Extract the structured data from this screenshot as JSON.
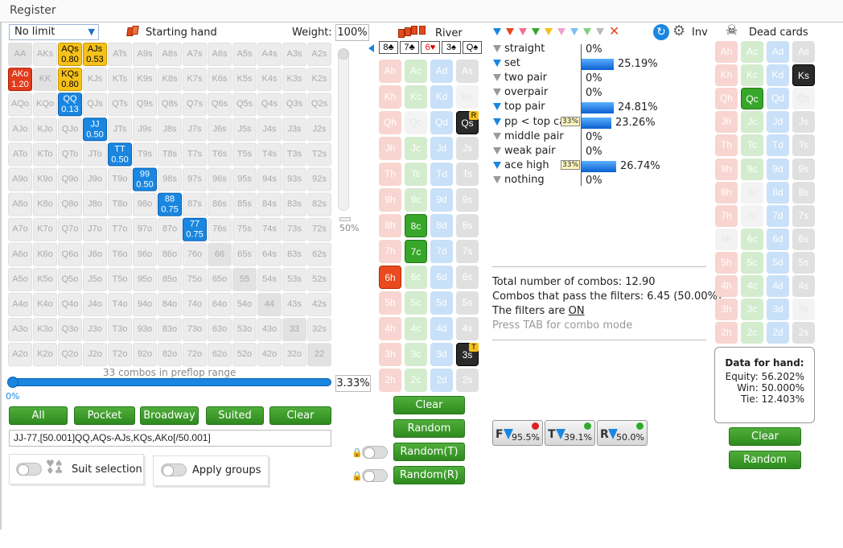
{
  "register": "Register",
  "limit": {
    "value": "No limit"
  },
  "starting_hand": "Starting hand",
  "weight": {
    "label": "Weight:",
    "value": "100%"
  },
  "slider_pct": "50%",
  "range_summary": "33 combos in preflop range",
  "range_pct": "3.33%",
  "range_left_pct": "0%",
  "grid": [
    [
      "AA",
      "AKs",
      "AQs|0.80",
      "AJs|0.53",
      "ATs",
      "A9s",
      "A8s",
      "A7s",
      "A6s",
      "A5s",
      "A4s",
      "A3s",
      "A2s"
    ],
    [
      "AKo|1.20",
      "KK",
      "KQs|0.80",
      "KJs",
      "KTs",
      "K9s",
      "K8s",
      "K7s",
      "K6s",
      "K5s",
      "K4s",
      "K3s",
      "K2s"
    ],
    [
      "AQo",
      "KQo",
      "QQ|0.13",
      "QJs",
      "QTs",
      "Q9s",
      "Q8s",
      "Q7s",
      "Q6s",
      "Q5s",
      "Q4s",
      "Q3s",
      "Q2s"
    ],
    [
      "AJo",
      "KJo",
      "QJo",
      "JJ|0.50",
      "JTs",
      "J9s",
      "J8s",
      "J7s",
      "J6s",
      "J5s",
      "J4s",
      "J3s",
      "J2s"
    ],
    [
      "ATo",
      "KTo",
      "QTo",
      "JTo",
      "TT|0.50",
      "T9s",
      "T8s",
      "T7s",
      "T6s",
      "T5s",
      "T4s",
      "T3s",
      "T2s"
    ],
    [
      "A9o",
      "K9o",
      "Q9o",
      "J9o",
      "T9o",
      "99|0.50",
      "98s",
      "97s",
      "96s",
      "95s",
      "94s",
      "93s",
      "92s"
    ],
    [
      "A8o",
      "K8o",
      "Q8o",
      "J8o",
      "T8o",
      "98o",
      "88|0.75",
      "87s",
      "86s",
      "85s",
      "84s",
      "83s",
      "82s"
    ],
    [
      "A7o",
      "K7o",
      "Q7o",
      "J7o",
      "T7o",
      "97o",
      "87o",
      "77|0.75",
      "76s",
      "75s",
      "74s",
      "73s",
      "72s"
    ],
    [
      "A6o",
      "K6o",
      "Q6o",
      "J6o",
      "T6o",
      "96o",
      "86o",
      "76o",
      "66",
      "65s",
      "64s",
      "63s",
      "62s"
    ],
    [
      "A5o",
      "K5o",
      "Q5o",
      "J5o",
      "T5o",
      "95o",
      "85o",
      "75o",
      "65o",
      "55",
      "54s",
      "53s",
      "52s"
    ],
    [
      "A4o",
      "K4o",
      "Q4o",
      "J4o",
      "T4o",
      "94o",
      "84o",
      "74o",
      "64o",
      "54o",
      "44",
      "43s",
      "42s"
    ],
    [
      "A3o",
      "K3o",
      "Q3o",
      "J3o",
      "T3o",
      "93o",
      "83o",
      "73o",
      "63o",
      "53o",
      "43o",
      "33",
      "32s"
    ],
    [
      "A2o",
      "K2o",
      "Q2o",
      "J2o",
      "T2o",
      "92o",
      "82o",
      "72o",
      "62o",
      "52o",
      "42o",
      "32o",
      "22"
    ]
  ],
  "preset_buttons": [
    "All",
    "Pocket",
    "Broadway",
    "Suited",
    "Clear"
  ],
  "range_text": "JJ-77,[50.001]QQ,AQs-AJs,KQs,AKo[/50.001]",
  "suit_selection": "Suit selection",
  "apply_groups": "Apply groups",
  "river": {
    "label": "River",
    "board": [
      "8♣",
      "7♣",
      "6♥",
      "3♠",
      "Q♠"
    ]
  },
  "ranks": [
    "A",
    "K",
    "Q",
    "J",
    "T",
    "9",
    "8",
    "7",
    "6",
    "5",
    "4",
    "3",
    "2"
  ],
  "mid_buttons": {
    "clear": "Clear",
    "random": "Random",
    "random_t": "Random(T)",
    "random_r": "Random(R)"
  },
  "inv": "Inv",
  "dead_cards": "Dead cards",
  "filters": [
    {
      "name": "straight",
      "pct": "0%",
      "w": 0,
      "on": false,
      "tag": ""
    },
    {
      "name": "set",
      "pct": "25.19%",
      "w": 0.2519,
      "on": true,
      "tag": ""
    },
    {
      "name": "two pair",
      "pct": "0%",
      "w": 0,
      "on": false,
      "tag": ""
    },
    {
      "name": "overpair",
      "pct": "0%",
      "w": 0,
      "on": false,
      "tag": ""
    },
    {
      "name": "top pair",
      "pct": "24.81%",
      "w": 0.2481,
      "on": true,
      "tag": ""
    },
    {
      "name": "pp < top card",
      "pct": "23.26%",
      "w": 0.2326,
      "on": true,
      "tag": "33%"
    },
    {
      "name": "middle pair",
      "pct": "0%",
      "w": 0,
      "on": false,
      "tag": ""
    },
    {
      "name": "weak pair",
      "pct": "0%",
      "w": 0,
      "on": false,
      "tag": ""
    },
    {
      "name": "ace high",
      "pct": "26.74%",
      "w": 0.2674,
      "on": true,
      "tag": "33%"
    },
    {
      "name": "nothing",
      "pct": "0%",
      "w": 0,
      "on": false,
      "tag": ""
    }
  ],
  "stats": {
    "total": "Total number of combos: 12.90",
    "pass": "Combos that pass the filters: 6.45 (50.00%)",
    "filters_are": "The filters are ",
    "on_word": "ON",
    "hint": "Press TAB for combo mode"
  },
  "fbuttons": [
    {
      "l": "F",
      "v": "95.5%",
      "c": "#e02020"
    },
    {
      "l": "T",
      "v": "39.1%",
      "c": "#2faa2a"
    },
    {
      "l": "R",
      "v": "50.0%",
      "c": "#2faa2a"
    }
  ],
  "hand_data": {
    "title": "Data for hand:",
    "equity": "Equity: 56.202%",
    "win": "Win: 50.000%",
    "tie": "Tie: 12.403%"
  },
  "dead_buttons": {
    "clear": "Clear",
    "random": "Random"
  },
  "colors": {
    "accent": "#1a86e0",
    "green": "#37a62a",
    "gold": "#f5c11a",
    "red": "#e23b1e"
  }
}
